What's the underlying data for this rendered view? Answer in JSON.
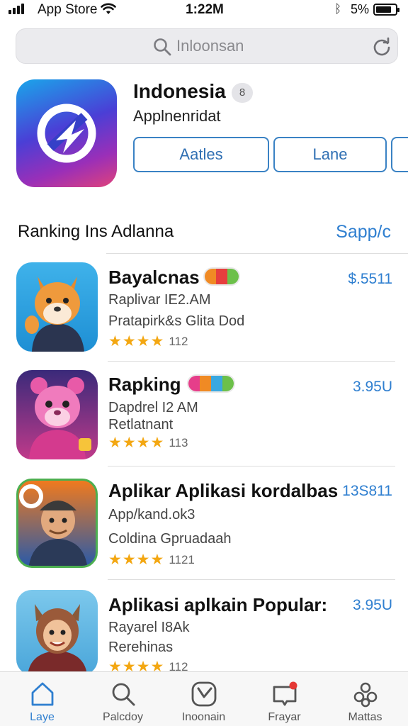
{
  "status_bar": {
    "carrier": "App Store",
    "time": "1:22M",
    "battery_text": "5%",
    "battery_level": 0.8
  },
  "search": {
    "placeholder": "Inloonsan"
  },
  "featured": {
    "title": "Indonesia",
    "badge": "8",
    "subtitle": "Applnenridat",
    "button_left": "Aatles",
    "button_right": "Lane"
  },
  "section": {
    "title": "Ranking Ins Adlanna",
    "link": "Sapp/c"
  },
  "apps": [
    {
      "name": "Bayalcnas",
      "price": "$.5511",
      "meta1": "Raplivar IE2.AM",
      "meta2": "Pratapirk&s Glita Dod",
      "rating": "112",
      "stars": 4,
      "icon": "fox-character-icon"
    },
    {
      "name": "Rapking",
      "price": "3.95U",
      "meta1": "Dapdrel I2 AM",
      "meta2": "Retlatnant",
      "rating": "113",
      "stars": 4,
      "icon": "pink-bear-character-icon"
    },
    {
      "name": "Aplikar Aplikasi kordalbas",
      "price": "13S811",
      "meta1": "App/kand.ok3",
      "meta2": "Coldina Gpruadaah",
      "rating": "1121",
      "stars": 4,
      "icon": "man-character-icon"
    },
    {
      "name": "Aplikasi aplkain Popular:",
      "price": "3.95U",
      "meta1": "Rayarel I8Ak",
      "meta2": "Rerehinas",
      "rating": "112",
      "stars": 4,
      "icon": "girl-character-icon"
    }
  ],
  "tabs": [
    {
      "label": "Laye",
      "icon": "home-icon",
      "active": true
    },
    {
      "label": "Palcdoy",
      "icon": "search-icon",
      "active": false
    },
    {
      "label": "Inoonain",
      "icon": "check-icon",
      "active": false
    },
    {
      "label": "Frayar",
      "icon": "notification-icon",
      "active": false
    },
    {
      "label": "Mattas",
      "icon": "settings-icon",
      "active": false
    }
  ],
  "colors": {
    "accent": "#2f7fd0",
    "star": "#f3a712"
  }
}
